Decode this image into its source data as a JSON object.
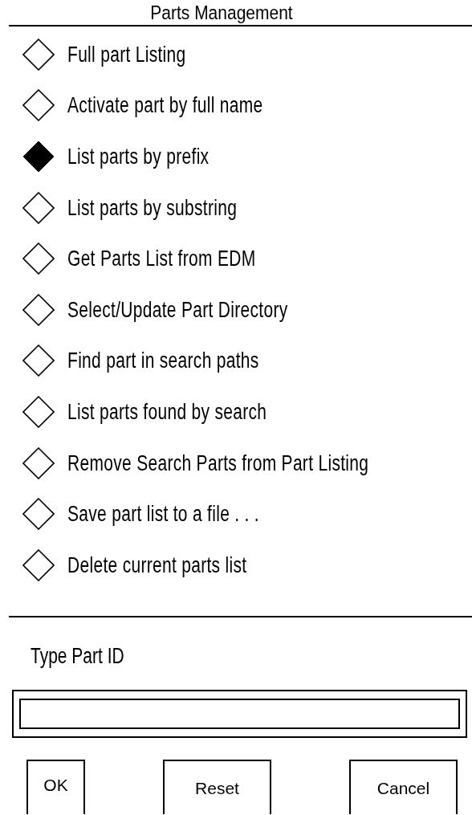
{
  "title": "Parts Management",
  "options": [
    {
      "label": "Full part Listing",
      "selected": false
    },
    {
      "label": "Activate part by full name",
      "selected": false
    },
    {
      "label": "List parts by prefix",
      "selected": true
    },
    {
      "label": "List parts by substring",
      "selected": false
    },
    {
      "label": "Get Parts List from EDM",
      "selected": false
    },
    {
      "label": "Select/Update Part Directory",
      "selected": false
    },
    {
      "label": "Find part in search paths",
      "selected": false
    },
    {
      "label": "List parts found by search",
      "selected": false
    },
    {
      "label": "Remove Search Parts from Part Listing",
      "selected": false
    },
    {
      "label": "Save part list to a file . . .",
      "selected": false
    },
    {
      "label": "Delete current parts list",
      "selected": false
    }
  ],
  "field": {
    "label": "Type Part ID"
  },
  "buttons": [
    "OK",
    "Reset",
    "Cancel"
  ]
}
